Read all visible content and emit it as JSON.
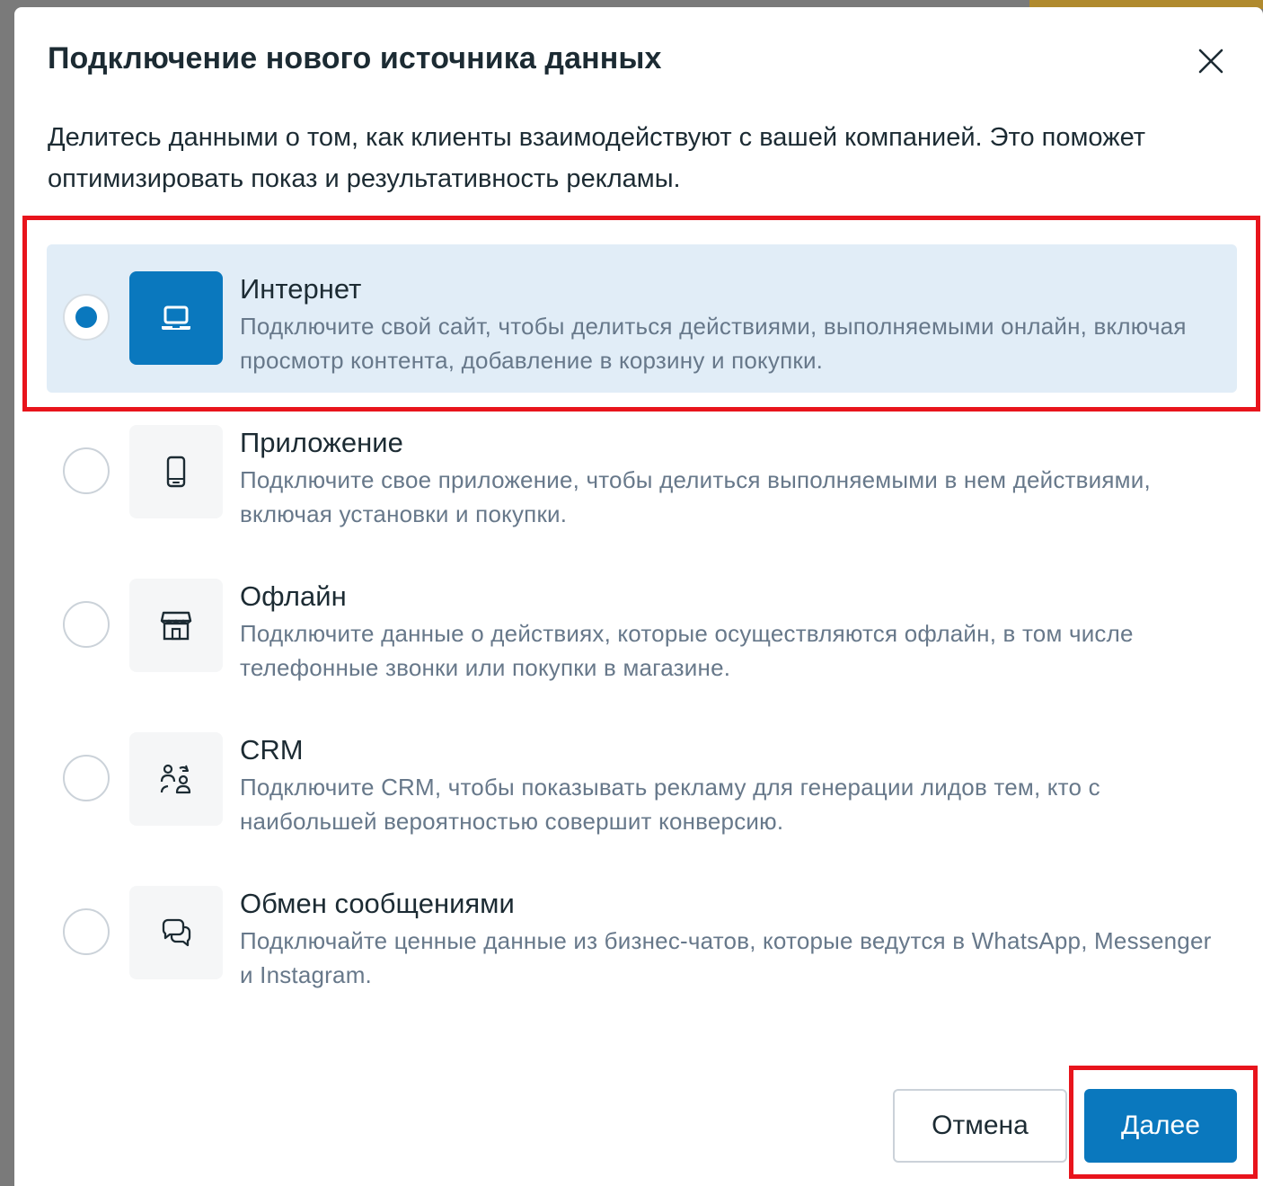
{
  "dialog": {
    "title": "Подключение нового источника данных",
    "description": "Делитесь данными о том, как клиенты взаимодействуют с вашей компанией. Это поможет оптимизировать показ и результативность рекламы.",
    "close_icon": "close-icon"
  },
  "options": [
    {
      "title": "Интернет",
      "description": "Подключите свой сайт, чтобы делиться действиями, выполняемыми онлайн, включая просмотр контента, добавление в корзину и покупки.",
      "icon": "laptop-icon",
      "selected": true
    },
    {
      "title": "Приложение",
      "description": "Подключите свое приложение, чтобы делиться выполняемыми в нем действиями, включая установки и покупки.",
      "icon": "mobile-phone-icon",
      "selected": false
    },
    {
      "title": "Офлайн",
      "description": "Подключите данные о действиях, которые осуществляются офлайн, в том числе телефонные звонки или покупки в магазине.",
      "icon": "storefront-icon",
      "selected": false
    },
    {
      "title": "CRM",
      "description": "Подключите CRM, чтобы показывать рекламу для генерации лидов тем, кто с наибольшей вероятностью совершит конверсию.",
      "icon": "people-exchange-icon",
      "selected": false
    },
    {
      "title": "Обмен сообщениями",
      "description": "Подключайте ценные данные из бизнес-чатов, которые ведутся в WhatsApp, Messenger и Instagram.",
      "icon": "chat-bubbles-icon",
      "selected": false
    }
  ],
  "footer": {
    "cancel_label": "Отмена",
    "next_label": "Далее"
  },
  "colors": {
    "accent": "#0a78be",
    "selected_background": "#e1edf7",
    "annotation_highlight": "#e8141c",
    "text_primary": "#1c2b33",
    "text_secondary": "#67788a"
  }
}
